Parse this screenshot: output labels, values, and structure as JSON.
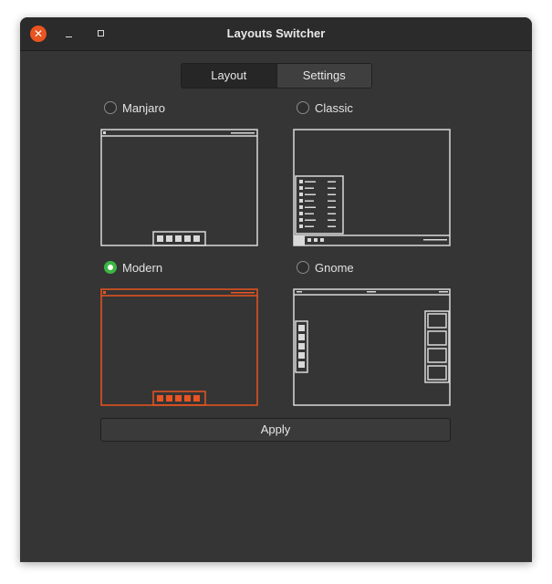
{
  "window": {
    "title": "Layouts Switcher"
  },
  "titlebar": {
    "close_symbol": "✕"
  },
  "tabs": [
    {
      "label": "Layout",
      "active": true
    },
    {
      "label": "Settings",
      "active": false
    }
  ],
  "layouts": [
    {
      "label": "Manjaro",
      "selected": false
    },
    {
      "label": "Classic",
      "selected": false
    },
    {
      "label": "Modern",
      "selected": true
    },
    {
      "label": "Gnome",
      "selected": false
    }
  ],
  "apply_label": "Apply",
  "colors": {
    "accent": "#e95420",
    "selected_radio": "#3cb643",
    "preview_line": "#d9d9d9"
  }
}
